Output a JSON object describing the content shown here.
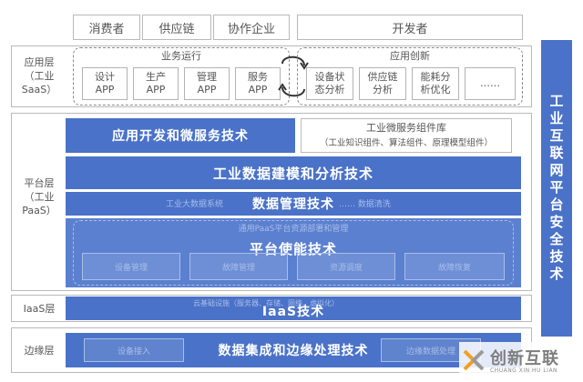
{
  "top": {
    "consumer": "消费者",
    "supply_chain": "供应链",
    "partner": "协作企业",
    "developer": "开发者"
  },
  "saas": {
    "layer_label": "应用层\n（工业SaaS）",
    "ops_title": "业务运行",
    "ops_apps": [
      "设计\nAPP",
      "生产\nAPP",
      "管理\nAPP",
      "服务\nAPP"
    ],
    "innov_title": "应用创新",
    "innov_apps": [
      "设备状\n态分析",
      "供应链\n分析",
      "能耗分\n析优化",
      "……"
    ]
  },
  "paas": {
    "layer_label": "平台层\n（工业PaaS）",
    "band_app_dev": "应用开发和微服务技术",
    "lib_title": "工业微服务组件库",
    "lib_sub": "（工业知识组件、算法组件、原理模型组件）",
    "band_modeling": "工业数据建模和分析技术",
    "band_data_mgmt": "数据管理技术",
    "ghost_data_mgmt": "工业大数据系统",
    "ghost_data_mgmt_right": "……    数据清洗",
    "ghost_platform_title": "通用PaaS平台资源部署和管理",
    "band_enabling": "平台使能技术",
    "ghost_boxes": [
      "设备管理",
      "故障管理",
      "资源调度",
      "故障恢复"
    ]
  },
  "iaas": {
    "layer_label": "IaaS层",
    "band": "IaaS技术",
    "ghost_text": "云基础设施（服务器、存储、网络、虚拟化）"
  },
  "edge": {
    "layer_label": "边缘层",
    "band": "数据集成和边缘处理技术",
    "ghost_left": "设备接入",
    "ghost_right": "边缘数据处理"
  },
  "side": {
    "label": "工业互联网平台安全技术"
  },
  "logo": {
    "name": "创新互联",
    "sub": "CHUANG XIN HU LIAN"
  },
  "colors": {
    "band_blue": "#4a72c8",
    "border_gray": "#b9b9b9"
  }
}
